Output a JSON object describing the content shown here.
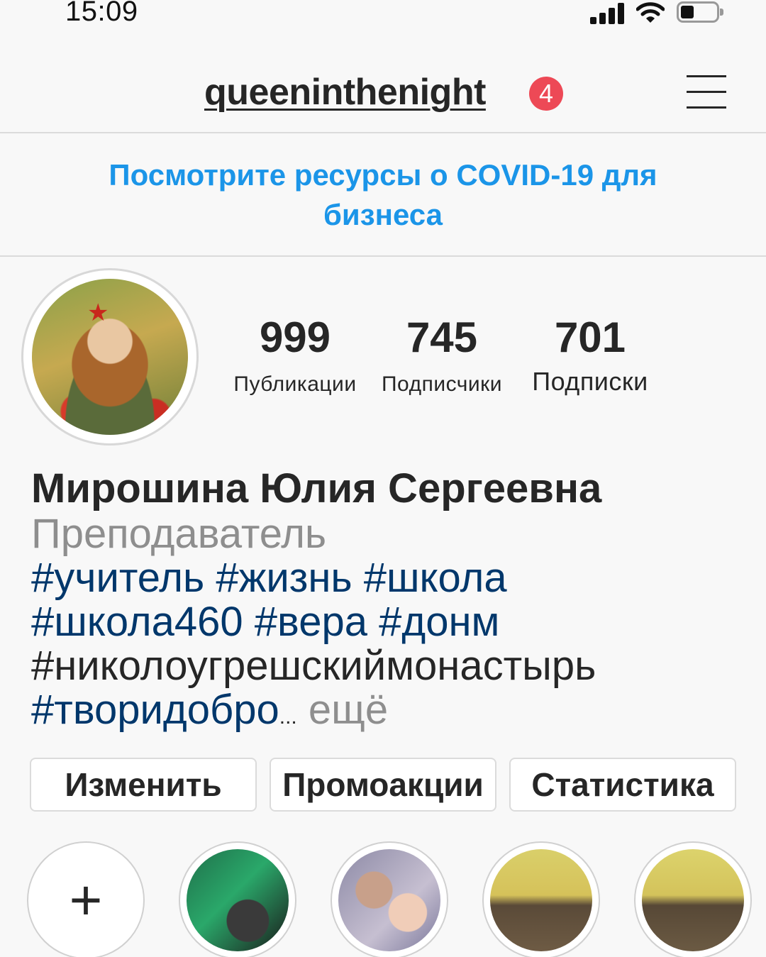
{
  "status_bar": {
    "time": "15:09"
  },
  "header": {
    "username": "queeninthenight",
    "notification_count": "4"
  },
  "banner": {
    "text": "Посмотрите ресурсы о COVID-19 для бизнеса"
  },
  "profile": {
    "stats": [
      {
        "value": "999",
        "label": "Публикации"
      },
      {
        "value": "745",
        "label": "Подписчики"
      },
      {
        "value": "701",
        "label": "Подписки"
      }
    ],
    "name": "Мирошина Юлия Сергеевна",
    "category": "Преподаватель",
    "bio_tags": {
      "t1": "#учитель",
      "t2": "#жизнь",
      "t3": "#школа",
      "t4": "#школа460",
      "t5": "#вера",
      "t6": "#донм",
      "t7": "#николоугрешскиймонастырь",
      "t8": "#творидобро"
    },
    "ellipsis": "...",
    "more": "ещё"
  },
  "buttons": {
    "edit": "Изменить",
    "promo": "Промоакции",
    "stats": "Статистика"
  },
  "highlights": {
    "new_symbol": "+"
  },
  "colors": {
    "link_blue": "#1b95e8",
    "hashtag": "#00376b",
    "badge_red": "#ed4956",
    "muted": "#8e8e8e"
  },
  "icons": [
    "signal-icon",
    "wifi-icon",
    "battery-icon",
    "menu-icon",
    "plus-icon"
  ]
}
